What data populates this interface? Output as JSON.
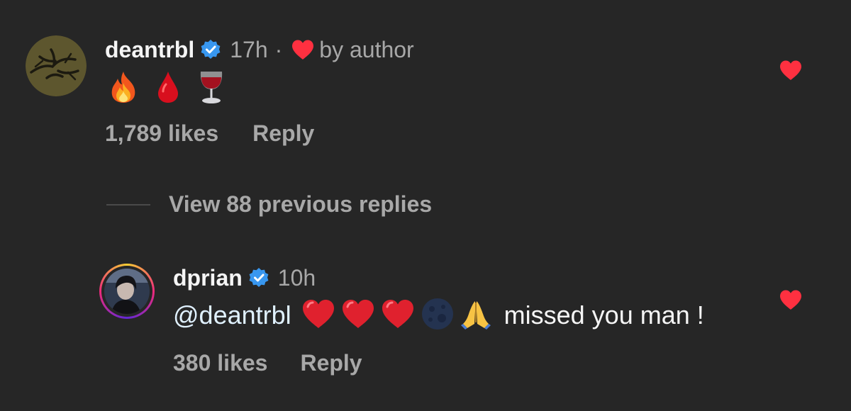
{
  "comments": [
    {
      "username": "deantrbl",
      "verified": true,
      "time": "17h",
      "separator": "·",
      "liked_by_author_label": "by author",
      "body_emojis": [
        "fire-emoji",
        "drop-of-blood-emoji",
        "wine-glass-emoji"
      ],
      "likes": "1,789 likes",
      "reply_label": "Reply",
      "liked": true
    },
    {
      "username": "dprian",
      "verified": true,
      "time": "10h",
      "mention": "@deantrbl",
      "body_emojis": [
        "red-heart-emoji",
        "red-heart-emoji",
        "red-heart-emoji",
        "new-moon-emoji",
        "folded-hands-emoji"
      ],
      "text": "missed you man !",
      "likes": "380 likes",
      "reply_label": "Reply",
      "liked": true
    }
  ],
  "view_replies_label": "View 88 previous replies",
  "colors": {
    "background": "#262626",
    "heart": "#ff3040",
    "verified": "#3897f0",
    "muted_text": "#a8a8a8"
  }
}
